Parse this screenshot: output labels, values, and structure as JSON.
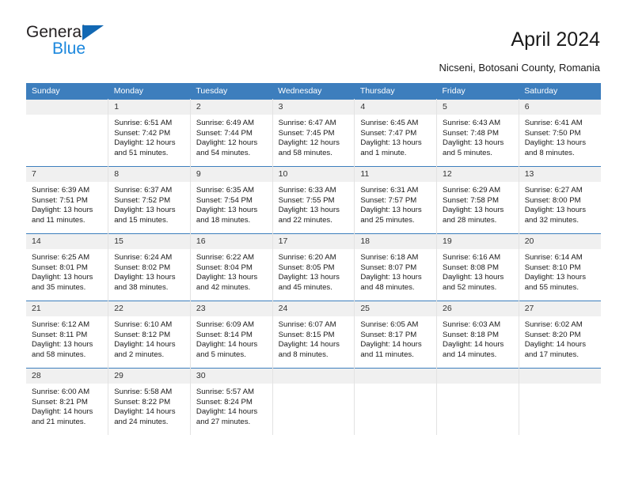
{
  "brand": {
    "name_part1": "General",
    "name_part2": "Blue",
    "triangle_color": "#1268b3",
    "blue_text_color": "#1b87dd"
  },
  "header": {
    "title": "April 2024",
    "subtitle": "Nicseni, Botosani County, Romania",
    "header_bg_color": "#3d7ebd",
    "daynum_bg_color": "#f0f0f0"
  },
  "weekday_headers": [
    "Sunday",
    "Monday",
    "Tuesday",
    "Wednesday",
    "Thursday",
    "Friday",
    "Saturday"
  ],
  "weeks": [
    [
      {
        "day": "",
        "sunrise": "",
        "sunset": "",
        "daylight_1": "",
        "daylight_2": "",
        "blank": true
      },
      {
        "day": "1",
        "sunrise": "Sunrise: 6:51 AM",
        "sunset": "Sunset: 7:42 PM",
        "daylight_1": "Daylight: 12 hours",
        "daylight_2": "and 51 minutes."
      },
      {
        "day": "2",
        "sunrise": "Sunrise: 6:49 AM",
        "sunset": "Sunset: 7:44 PM",
        "daylight_1": "Daylight: 12 hours",
        "daylight_2": "and 54 minutes."
      },
      {
        "day": "3",
        "sunrise": "Sunrise: 6:47 AM",
        "sunset": "Sunset: 7:45 PM",
        "daylight_1": "Daylight: 12 hours",
        "daylight_2": "and 58 minutes."
      },
      {
        "day": "4",
        "sunrise": "Sunrise: 6:45 AM",
        "sunset": "Sunset: 7:47 PM",
        "daylight_1": "Daylight: 13 hours",
        "daylight_2": "and 1 minute."
      },
      {
        "day": "5",
        "sunrise": "Sunrise: 6:43 AM",
        "sunset": "Sunset: 7:48 PM",
        "daylight_1": "Daylight: 13 hours",
        "daylight_2": "and 5 minutes."
      },
      {
        "day": "6",
        "sunrise": "Sunrise: 6:41 AM",
        "sunset": "Sunset: 7:50 PM",
        "daylight_1": "Daylight: 13 hours",
        "daylight_2": "and 8 minutes."
      }
    ],
    [
      {
        "day": "7",
        "sunrise": "Sunrise: 6:39 AM",
        "sunset": "Sunset: 7:51 PM",
        "daylight_1": "Daylight: 13 hours",
        "daylight_2": "and 11 minutes."
      },
      {
        "day": "8",
        "sunrise": "Sunrise: 6:37 AM",
        "sunset": "Sunset: 7:52 PM",
        "daylight_1": "Daylight: 13 hours",
        "daylight_2": "and 15 minutes."
      },
      {
        "day": "9",
        "sunrise": "Sunrise: 6:35 AM",
        "sunset": "Sunset: 7:54 PM",
        "daylight_1": "Daylight: 13 hours",
        "daylight_2": "and 18 minutes."
      },
      {
        "day": "10",
        "sunrise": "Sunrise: 6:33 AM",
        "sunset": "Sunset: 7:55 PM",
        "daylight_1": "Daylight: 13 hours",
        "daylight_2": "and 22 minutes."
      },
      {
        "day": "11",
        "sunrise": "Sunrise: 6:31 AM",
        "sunset": "Sunset: 7:57 PM",
        "daylight_1": "Daylight: 13 hours",
        "daylight_2": "and 25 minutes."
      },
      {
        "day": "12",
        "sunrise": "Sunrise: 6:29 AM",
        "sunset": "Sunset: 7:58 PM",
        "daylight_1": "Daylight: 13 hours",
        "daylight_2": "and 28 minutes."
      },
      {
        "day": "13",
        "sunrise": "Sunrise: 6:27 AM",
        "sunset": "Sunset: 8:00 PM",
        "daylight_1": "Daylight: 13 hours",
        "daylight_2": "and 32 minutes."
      }
    ],
    [
      {
        "day": "14",
        "sunrise": "Sunrise: 6:25 AM",
        "sunset": "Sunset: 8:01 PM",
        "daylight_1": "Daylight: 13 hours",
        "daylight_2": "and 35 minutes."
      },
      {
        "day": "15",
        "sunrise": "Sunrise: 6:24 AM",
        "sunset": "Sunset: 8:02 PM",
        "daylight_1": "Daylight: 13 hours",
        "daylight_2": "and 38 minutes."
      },
      {
        "day": "16",
        "sunrise": "Sunrise: 6:22 AM",
        "sunset": "Sunset: 8:04 PM",
        "daylight_1": "Daylight: 13 hours",
        "daylight_2": "and 42 minutes."
      },
      {
        "day": "17",
        "sunrise": "Sunrise: 6:20 AM",
        "sunset": "Sunset: 8:05 PM",
        "daylight_1": "Daylight: 13 hours",
        "daylight_2": "and 45 minutes."
      },
      {
        "day": "18",
        "sunrise": "Sunrise: 6:18 AM",
        "sunset": "Sunset: 8:07 PM",
        "daylight_1": "Daylight: 13 hours",
        "daylight_2": "and 48 minutes."
      },
      {
        "day": "19",
        "sunrise": "Sunrise: 6:16 AM",
        "sunset": "Sunset: 8:08 PM",
        "daylight_1": "Daylight: 13 hours",
        "daylight_2": "and 52 minutes."
      },
      {
        "day": "20",
        "sunrise": "Sunrise: 6:14 AM",
        "sunset": "Sunset: 8:10 PM",
        "daylight_1": "Daylight: 13 hours",
        "daylight_2": "and 55 minutes."
      }
    ],
    [
      {
        "day": "21",
        "sunrise": "Sunrise: 6:12 AM",
        "sunset": "Sunset: 8:11 PM",
        "daylight_1": "Daylight: 13 hours",
        "daylight_2": "and 58 minutes."
      },
      {
        "day": "22",
        "sunrise": "Sunrise: 6:10 AM",
        "sunset": "Sunset: 8:12 PM",
        "daylight_1": "Daylight: 14 hours",
        "daylight_2": "and 2 minutes."
      },
      {
        "day": "23",
        "sunrise": "Sunrise: 6:09 AM",
        "sunset": "Sunset: 8:14 PM",
        "daylight_1": "Daylight: 14 hours",
        "daylight_2": "and 5 minutes."
      },
      {
        "day": "24",
        "sunrise": "Sunrise: 6:07 AM",
        "sunset": "Sunset: 8:15 PM",
        "daylight_1": "Daylight: 14 hours",
        "daylight_2": "and 8 minutes."
      },
      {
        "day": "25",
        "sunrise": "Sunrise: 6:05 AM",
        "sunset": "Sunset: 8:17 PM",
        "daylight_1": "Daylight: 14 hours",
        "daylight_2": "and 11 minutes."
      },
      {
        "day": "26",
        "sunrise": "Sunrise: 6:03 AM",
        "sunset": "Sunset: 8:18 PM",
        "daylight_1": "Daylight: 14 hours",
        "daylight_2": "and 14 minutes."
      },
      {
        "day": "27",
        "sunrise": "Sunrise: 6:02 AM",
        "sunset": "Sunset: 8:20 PM",
        "daylight_1": "Daylight: 14 hours",
        "daylight_2": "and 17 minutes."
      }
    ],
    [
      {
        "day": "28",
        "sunrise": "Sunrise: 6:00 AM",
        "sunset": "Sunset: 8:21 PM",
        "daylight_1": "Daylight: 14 hours",
        "daylight_2": "and 21 minutes."
      },
      {
        "day": "29",
        "sunrise": "Sunrise: 5:58 AM",
        "sunset": "Sunset: 8:22 PM",
        "daylight_1": "Daylight: 14 hours",
        "daylight_2": "and 24 minutes."
      },
      {
        "day": "30",
        "sunrise": "Sunrise: 5:57 AM",
        "sunset": "Sunset: 8:24 PM",
        "daylight_1": "Daylight: 14 hours",
        "daylight_2": "and 27 minutes."
      },
      {
        "day": "",
        "sunrise": "",
        "sunset": "",
        "daylight_1": "",
        "daylight_2": "",
        "blank": true
      },
      {
        "day": "",
        "sunrise": "",
        "sunset": "",
        "daylight_1": "",
        "daylight_2": "",
        "blank": true
      },
      {
        "day": "",
        "sunrise": "",
        "sunset": "",
        "daylight_1": "",
        "daylight_2": "",
        "blank": true
      },
      {
        "day": "",
        "sunrise": "",
        "sunset": "",
        "daylight_1": "",
        "daylight_2": "",
        "blank": true
      }
    ]
  ]
}
